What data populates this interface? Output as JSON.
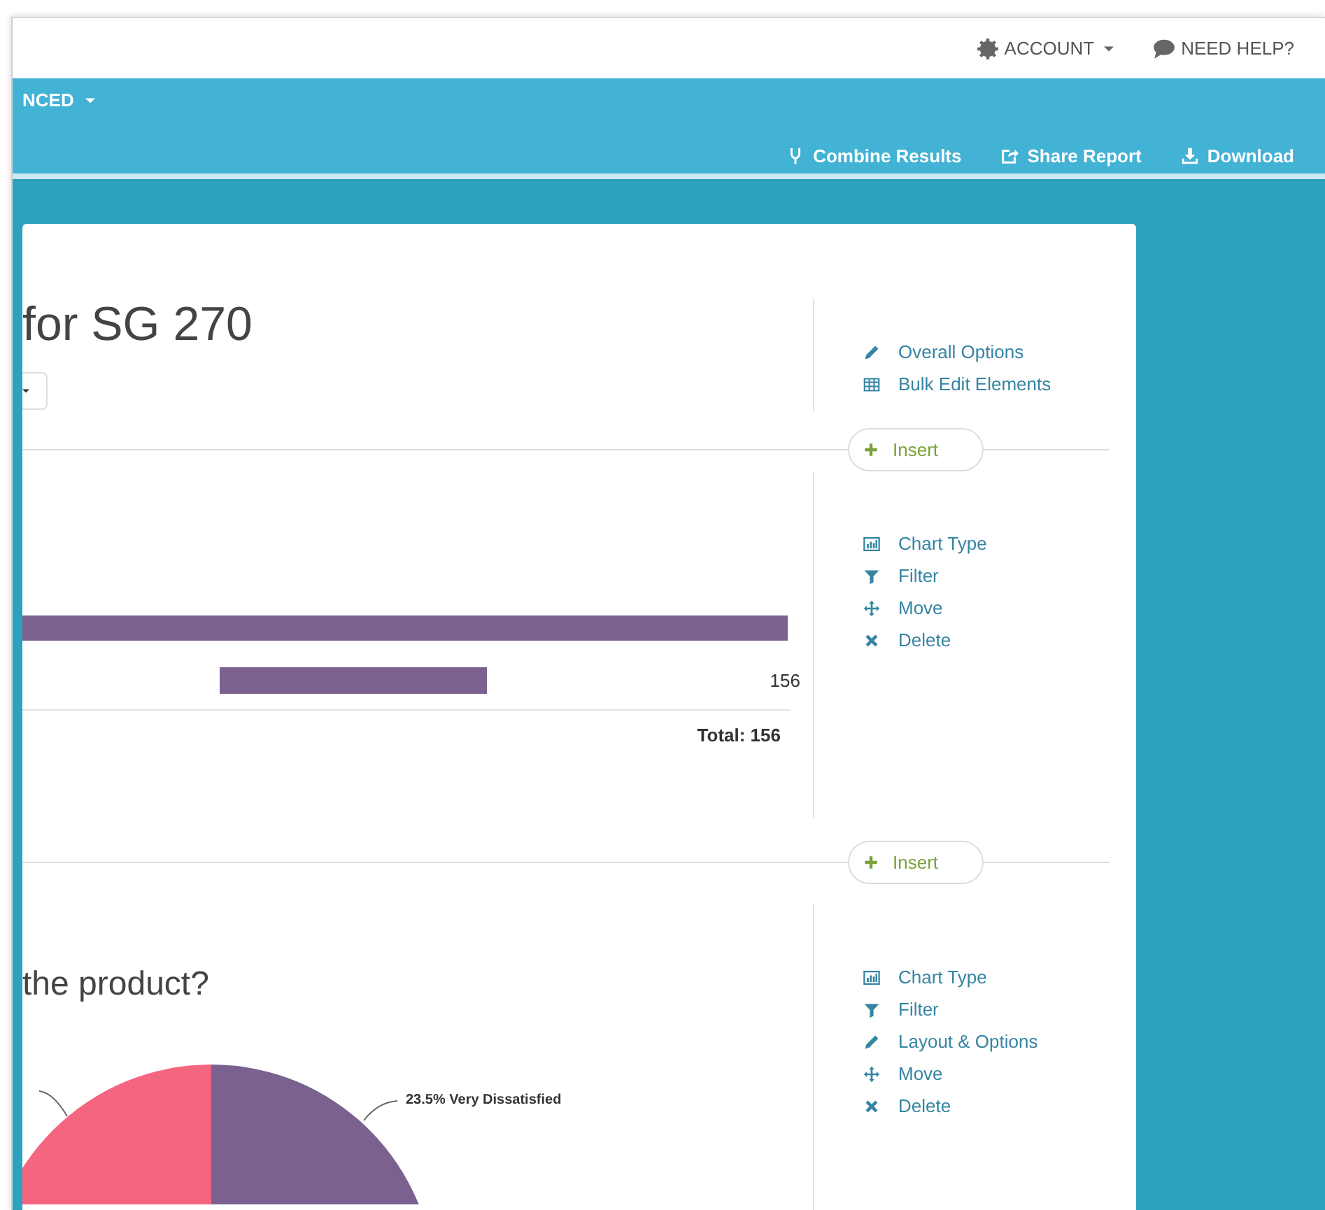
{
  "header": {
    "links": [
      {
        "label": "ACCOUNT",
        "kind": "account"
      },
      {
        "label": "NEED HELP?",
        "kind": "help"
      }
    ]
  },
  "nav": {
    "menu": {
      "label": "NCED"
    },
    "actions": [
      {
        "label": "Combine Results",
        "kind": "combine"
      },
      {
        "label": "Share Report",
        "kind": "share"
      },
      {
        "label": "Download",
        "kind": "download"
      }
    ]
  },
  "blocks": [
    {
      "kind": "header",
      "title": "for SG 270",
      "actions": [
        {
          "label": "Overall Options",
          "kind": "options"
        },
        {
          "label": "Bulk Edit Elements",
          "kind": "bulk_edit"
        }
      ]
    },
    {
      "kind": "insert",
      "label": "Insert"
    },
    {
      "kind": "bar_chart",
      "value_label": "156",
      "total": "Total: 156",
      "actions": [
        {
          "label": "Chart Type",
          "kind": "chart_type"
        },
        {
          "label": "Filter",
          "kind": "filter"
        },
        {
          "label": "Move",
          "kind": "move"
        },
        {
          "label": "Delete",
          "kind": "delete"
        }
      ]
    },
    {
      "kind": "insert",
      "label": "Insert"
    },
    {
      "kind": "pie_chart",
      "title": "the product?",
      "slices": [
        {
          "color": "#f4657f"
        },
        {
          "color": "#7b6190"
        }
      ],
      "slice_label": "23.5% Very Dissatisfied",
      "actions": [
        {
          "label": "Chart Type",
          "kind": "chart_type"
        },
        {
          "label": "Filter",
          "kind": "filter"
        },
        {
          "label": "Layout & Options",
          "kind": "options"
        },
        {
          "label": "Move",
          "kind": "move"
        },
        {
          "label": "Delete",
          "kind": "delete"
        }
      ]
    }
  ]
}
